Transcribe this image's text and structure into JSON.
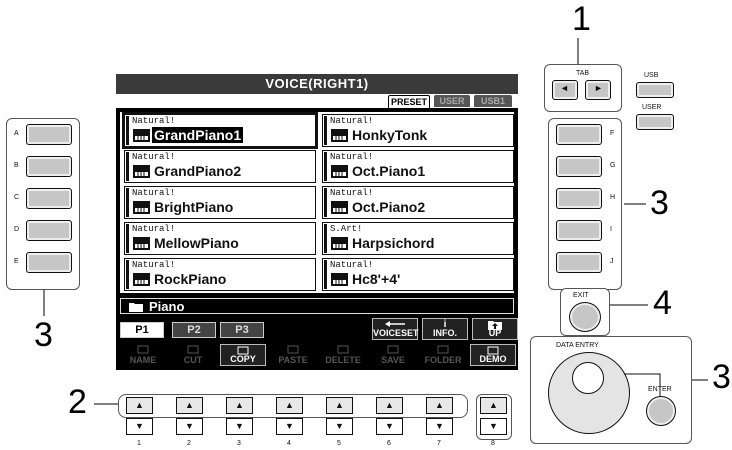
{
  "screen": {
    "title": "VOICE(RIGHT1)",
    "preset_tabs": [
      "PRESET",
      "USER",
      "USB1"
    ],
    "voices": [
      {
        "category": "Natural!",
        "name": "GrandPiano1",
        "selected": true
      },
      {
        "category": "Natural!",
        "name": "HonkyTonk"
      },
      {
        "category": "Natural!",
        "name": "GrandPiano2"
      },
      {
        "category": "Natural!",
        "name": "Oct.Piano1"
      },
      {
        "category": "Natural!",
        "name": "BrightPiano"
      },
      {
        "category": "Natural!",
        "name": "Oct.Piano2"
      },
      {
        "category": "Natural!",
        "name": "MellowPiano"
      },
      {
        "category": "S.Art!",
        "name": "Harpsichord"
      },
      {
        "category": "Natural!",
        "name": "RockPiano"
      },
      {
        "category": "Natural!",
        "name": "Hc8'+4'"
      }
    ],
    "folder": "Piano",
    "page_tabs": [
      "P1",
      "P2",
      "P3"
    ],
    "top_fn": [
      {
        "label": "VOICESET",
        "icon": "arrow-left-icon"
      },
      {
        "label": "INFO.",
        "icon": "info-icon",
        "glyph": "i"
      },
      {
        "label": "UP",
        "icon": "folder-up-icon"
      }
    ],
    "bottom_fn": [
      {
        "label": "NAME",
        "active": false
      },
      {
        "label": "CUT",
        "active": false
      },
      {
        "label": "COPY",
        "active": true
      },
      {
        "label": "PASTE",
        "active": false
      },
      {
        "label": "DELETE",
        "active": false
      },
      {
        "label": "SAVE",
        "active": false
      },
      {
        "label": "FOLDER",
        "active": false
      },
      {
        "label": "DEMO",
        "active": true
      }
    ]
  },
  "left_buttons": [
    "A",
    "B",
    "C",
    "D",
    "E"
  ],
  "right_buttons": [
    "F",
    "G",
    "H",
    "I",
    "J"
  ],
  "number_buttons": [
    "1",
    "2",
    "3",
    "4",
    "5",
    "6",
    "7",
    "8"
  ],
  "tab": {
    "label": "TAB",
    "left": "◄",
    "right": "►"
  },
  "usb_label": "USB",
  "user_label": "USER",
  "exit_label": "EXIT",
  "data_entry_label": "DATA ENTRY",
  "enter_label": "ENTER",
  "callouts": {
    "tab": "1",
    "left": "3",
    "right": "3",
    "exit": "4",
    "bottom": "2",
    "dial": "3"
  },
  "arrows": {
    "up": "▲",
    "down": "▼"
  }
}
